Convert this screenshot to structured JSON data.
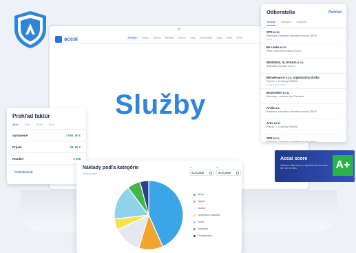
{
  "page_title": "Služby",
  "app": {
    "logo": "accai",
    "nav": [
      "Prehľad",
      "Banky",
      "Faktúry",
      "Náklady",
      "Zmluvy",
      "Karty",
      "Dodávatelia",
      "Zľavy",
      "Akcie",
      "Firmy"
    ]
  },
  "suppliers": {
    "title": "Odberatelia",
    "link": "Prehľad",
    "tabs": [
      "Všetko",
      "Najlepší",
      "Najhorší"
    ],
    "items": [
      {
        "name": "SPR s.r.o.",
        "address": "Bratislava, Karpatská námestie slobody 258/34",
        "meta": "Firma"
      },
      {
        "name": "Be Lenka s.r.o.",
        "address": "Žilina, Antona Bernoláka 2220/12",
        "meta": ""
      },
      {
        "name": "BENZINOL SLOVAKIA s.r.o.",
        "address": "Bratislava, Mlynské nivy 41",
        "meta": ""
      },
      {
        "name": "Bezvelisance s.r.o. organizačná zložka",
        "address": "Poprad, 1. Dunikady 3566/86",
        "meta": "1 neuhradená faktúra"
      },
      {
        "name": "BionicWise s.r.o.",
        "address": "Bratislava - mestská časť Petržalka",
        "meta": ""
      },
      {
        "name": "Ariela a.s.",
        "address": "Bratislava, Karpatská námestie slobody 258/34",
        "meta": ""
      },
      {
        "name": "Artis s.r.o.",
        "address": "Poprad, 1. Dunikady 3566/86",
        "meta": ""
      },
      {
        "name": "SPR s.r.o.",
        "address": "Bratislava, Karpatská námestie slobody 258/34",
        "meta": "Firma"
      }
    ]
  },
  "invoices": {
    "title": "Prehľad faktúr",
    "years": [
      "2021",
      "2020",
      "2019",
      "2018"
    ],
    "rows": [
      {
        "label": "Vystavené",
        "value": "3 068, 50 €"
      },
      {
        "label": "Prijaté",
        "value": "08, 90 €"
      },
      {
        "label": "Rozdiel",
        "value": "3 068"
      }
    ],
    "link": "Podrobnosti"
  },
  "score": {
    "title": "Accai score",
    "description": "Výborne! Vaša skóre je najvyššie ako nie ostne byť, ale nie dlhu.",
    "grade": "A+",
    "color": "#2bb34a"
  },
  "costs": {
    "title": "Náklady podľa kategórie",
    "subtitle": "Evidenci gem",
    "date_from_label": "Od",
    "date_from": "01.01.2020",
    "date_to_label": "Do",
    "date_to": "31.01.2020"
  },
  "chart_data": {
    "type": "pie",
    "categories": [
      "Mzdy",
      "Nájom",
      "Služby",
      "Spotrebný materiál",
      "Tovar",
      "Reklama",
      "Poradenstvo"
    ],
    "values": [
      42,
      11,
      13,
      5,
      16,
      6,
      4
    ],
    "colors": [
      "#3aa6e6",
      "#f2a432",
      "#e5e8ef",
      "#f4e34a",
      "#8ed3ea",
      "#43b54a",
      "#2d3e8a"
    ]
  }
}
